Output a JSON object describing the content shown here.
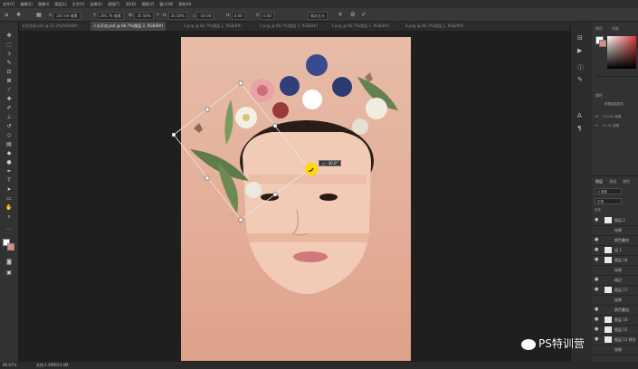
{
  "menu": [
    "文件(F)",
    "编辑(E)",
    "图像(I)",
    "图层(L)",
    "文字(Y)",
    "选择(S)",
    "滤镜(T)",
    "3D(D)",
    "视图(V)",
    "窗口(W)",
    "帮助(H)"
  ],
  "options": {
    "x_label": "X:",
    "x_value": "247.04 像素",
    "y_label": "Y:",
    "y_value": "291.76 像素",
    "w_label": "W:",
    "w_value": "35.56%",
    "h_label": "H:",
    "h_value": "35.56%",
    "angle_value": "-30.00",
    "h_skew_label": "H:",
    "h_skew_value": "0.00",
    "v_skew_label": "V:",
    "v_skew_value": "0.00",
    "interp": "两次立方",
    "commit_glyph": "✓",
    "cancel_glyph": "⊘"
  },
  "tabs": [
    {
      "label": "头发合成.psd @ 33.3%(RGB/8#)"
    },
    {
      "label": "人头开花.psd @ 66.7%(图层 2, RGB/8#)"
    },
    {
      "label": "1.png @ 66.7%(图层 1, RGB/8#)"
    },
    {
      "label": "2.png @ 66.7%(图层 1, RGB/8#)"
    },
    {
      "label": "3.png @ 66.7%(图层 1, RGB/8#)"
    },
    {
      "label": "4.png @ 66.7%(图层 1, RGB/8#)"
    }
  ],
  "angle_tooltip": "△: -30.0°",
  "status": {
    "zoom": "66.67%",
    "doc_info": "文档:1.49M/23.4M"
  },
  "panels": {
    "color_tabs": [
      "颜色",
      "色板"
    ],
    "properties_title": "属性",
    "props_sub": "像素图层属性",
    "w_field": "320.91 像素",
    "h_field": "21.31 像素",
    "layer_tabs": [
      "图层",
      "通道",
      "路径"
    ],
    "kind_filter": "Q 类型",
    "blend_mode": "正常",
    "lock_label": "锁定:",
    "layers": [
      {
        "name": "图层 2"
      },
      {
        "name": "效果"
      },
      {
        "name": "颜色叠加"
      },
      {
        "name": "组 1"
      },
      {
        "name": "图层 18"
      },
      {
        "name": "效果"
      },
      {
        "name": "描边"
      },
      {
        "name": "图层 17"
      },
      {
        "name": "效果"
      },
      {
        "name": "颜色叠加"
      },
      {
        "name": "图层 16"
      },
      {
        "name": "图层 15"
      },
      {
        "name": "图层 11 拷贝"
      },
      {
        "name": "效果"
      }
    ]
  },
  "watermark": "PS特训营",
  "colors": {
    "canvas_bg": "#e7bca8",
    "ui_dark": "#1e1e1e",
    "accent_yellow": "#ffd800",
    "watermark_text": "#ffffff"
  }
}
